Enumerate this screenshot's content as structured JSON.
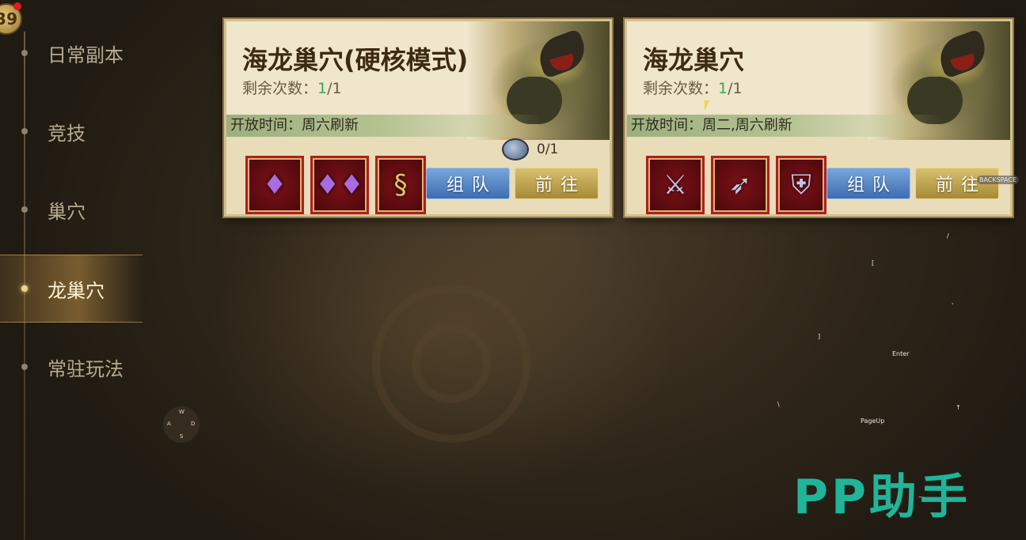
{
  "player": {
    "level_badge": "39"
  },
  "nav": {
    "items": [
      {
        "label": "日常副本",
        "active": false
      },
      {
        "label": "竞技",
        "active": false
      },
      {
        "label": "巢穴",
        "active": false
      },
      {
        "label": "龙巢穴",
        "active": true
      },
      {
        "label": "常驻玩法",
        "active": false
      }
    ]
  },
  "cards": [
    {
      "title": "海龙巢穴(硬核模式)",
      "remain_label": "剩余次数：",
      "remain_count": "1",
      "remain_total": "/1",
      "open_time": "开放时间：周六刷新",
      "token_count": "0/1",
      "rewards": [
        "necklace-icon",
        "earrings-icon",
        "pendant-icon"
      ],
      "team_button": "组队",
      "go_button": "前往"
    },
    {
      "title": "海龙巢穴",
      "remain_label": "剩余次数：",
      "remain_count": "1",
      "remain_total": "/1",
      "open_time": "开放时间：周二,周六刷新",
      "rewards": [
        "axe-icon",
        "bow-icon",
        "armor-icon"
      ],
      "team_button": "组队",
      "go_button": "前往"
    }
  ],
  "overlay": {
    "backspace": "BACKSPACE",
    "enter": "Enter",
    "pageup": "PageUp",
    "wasd": {
      "w": "W",
      "a": "A",
      "s": "S",
      "d": "D"
    },
    "symbols": [
      "/",
      "[",
      "'",
      "]",
      "\\",
      "↑",
      "—"
    ]
  },
  "watermark": "PP助手",
  "colors": {
    "accent_green": "#37a94a",
    "team_blue": "#3d6db2",
    "go_gold": "#a68a36"
  }
}
